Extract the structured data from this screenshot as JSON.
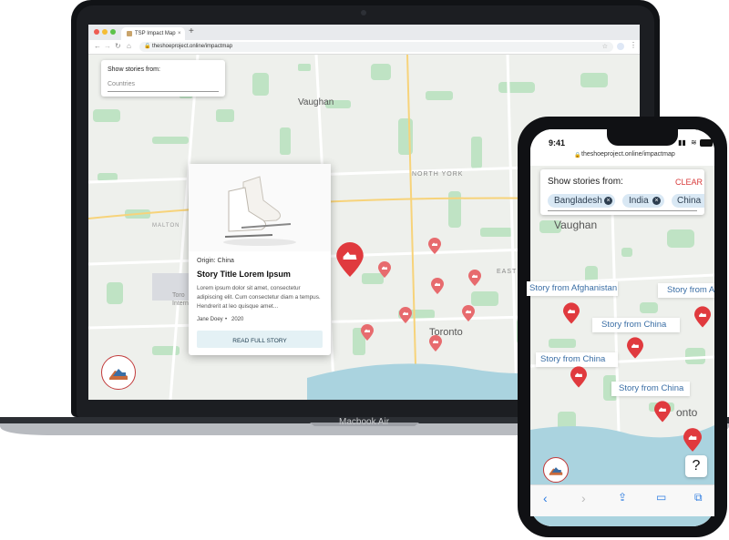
{
  "laptop": {
    "base_label": "Macbook Air",
    "browser": {
      "tab_title": "TSP Impact Map",
      "new_tab_symbol": "+",
      "url": "theshoeproject.online/impactmap"
    },
    "filter": {
      "title": "Show stories from:",
      "placeholder": "Countries"
    },
    "map_labels": {
      "vaughan": "Vaughan",
      "toronto": "Toronto",
      "north_york": "NORTH YORK",
      "east": "EAST",
      "malton": "MALTON",
      "toronto_intl": "Toro Intern"
    },
    "story_card": {
      "origin": "Origin: China",
      "title": "Story Title Lorem Ipsum",
      "body": "Lorem ipsum dolor sit amet, consectetur adipiscing elit. Cum consectetur diam a tempus. Hendrerit at leo quisque amet...",
      "author": "Jane Doey",
      "separator": "•",
      "year": "2020",
      "button": "READ FULL STORY"
    },
    "logo_text": "The Shoe Project"
  },
  "phone": {
    "time": "9:41",
    "url": "theshoeproject.online/impactmap",
    "filter": {
      "title": "Show stories from:",
      "clear": "CLEAR",
      "chips": [
        "Bangladesh",
        "India",
        "China"
      ]
    },
    "map_labels": {
      "vaughan": "Vaughan",
      "toronto": "onto"
    },
    "story_labels": [
      "Story from Afghanistan",
      "Story from A",
      "Story from China",
      "Story from China",
      "Story from China"
    ],
    "help": "?"
  },
  "colors": {
    "pin": "#e03a3e",
    "map_bg": "#eef0ec",
    "park": "#bfe3c4",
    "water": "#aad3df",
    "button_bg": "#e4f1f5",
    "clear": "#d83b3b"
  }
}
